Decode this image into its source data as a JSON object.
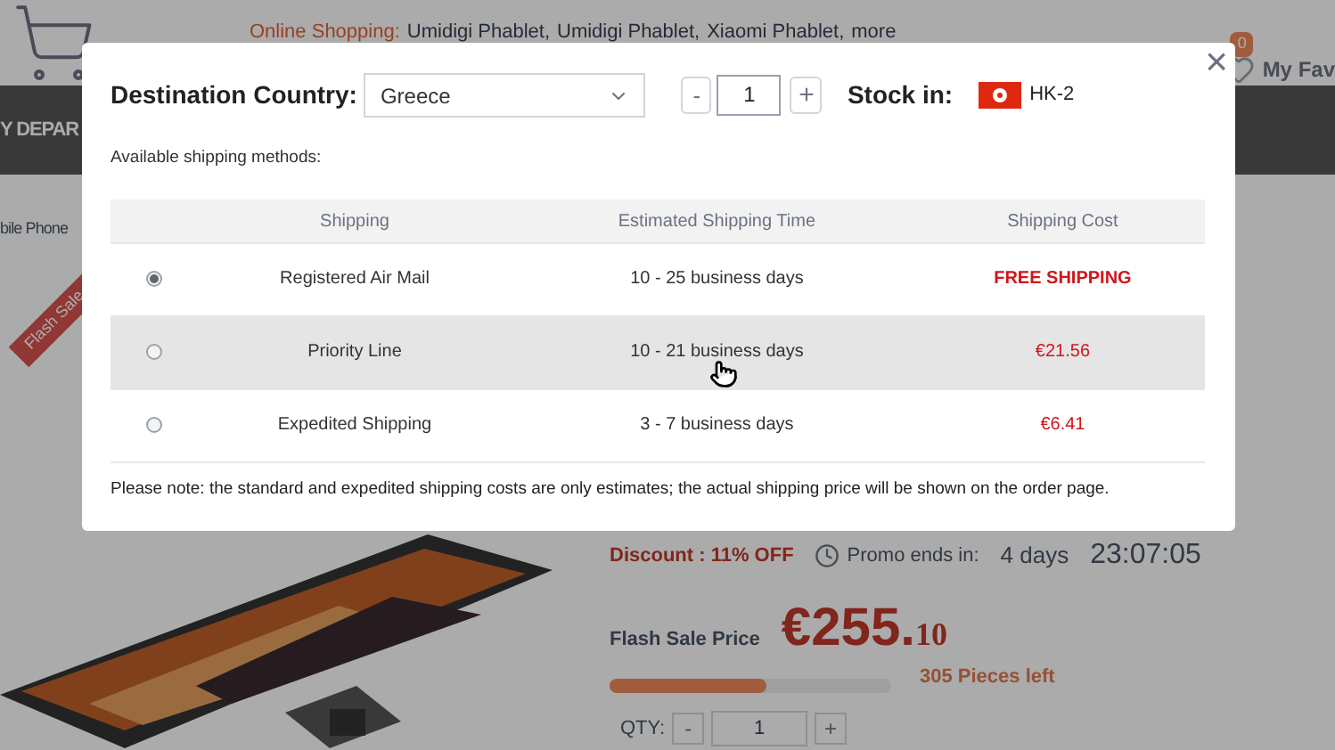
{
  "background_page": {
    "top_links": {
      "label": "Online Shopping:",
      "links": [
        "Umidigi Phablet,",
        "Umidigi Phablet,",
        "Xiaomi Phablet,",
        "more"
      ]
    },
    "favorites": {
      "count": "0",
      "label": "My Fav"
    },
    "nav_label": "Y DEPAR",
    "breadcrumb": "bile Phone",
    "ribbon": "Flash Sale",
    "discount": "Discount : 11% OFF",
    "promo": "Promo ends in:",
    "promo_days": "4 days",
    "promo_time": "23:07:05",
    "price_label": "Flash Sale Price",
    "price_main": "€255.",
    "price_cents": "10",
    "stock": {
      "level": 0.56,
      "text": "305 Pieces left"
    },
    "qty": {
      "label": "QTY:",
      "minus": "-",
      "value": "1",
      "plus": "+"
    }
  },
  "dialog": {
    "close": "×",
    "destination": {
      "label": "Destination Country:",
      "value": "Greece"
    },
    "quantity": {
      "minus": "-",
      "value": "1",
      "plus": "+"
    },
    "stock_in": {
      "label": "Stock in:",
      "warehouse": "HK-2"
    },
    "subtitle": "Available shipping methods:",
    "table": {
      "columns": [
        "Shipping",
        "Estimated Shipping Time",
        "Shipping Cost"
      ],
      "rows": [
        {
          "method": "Registered Air Mail",
          "time": "10 - 25 business days",
          "cost": "FREE SHIPPING",
          "selected": true,
          "hovered": false
        },
        {
          "method": "Priority Line",
          "time": "10 - 21 business days",
          "cost": "€21.56",
          "selected": false,
          "hovered": true
        },
        {
          "method": "Expedited Shipping",
          "time": "3 - 7 business days",
          "cost": "€6.41",
          "selected": false,
          "hovered": false
        }
      ]
    },
    "note": "Please note: the standard and expedited shipping costs are only estimates; the actual shipping price will be shown on the order page."
  }
}
